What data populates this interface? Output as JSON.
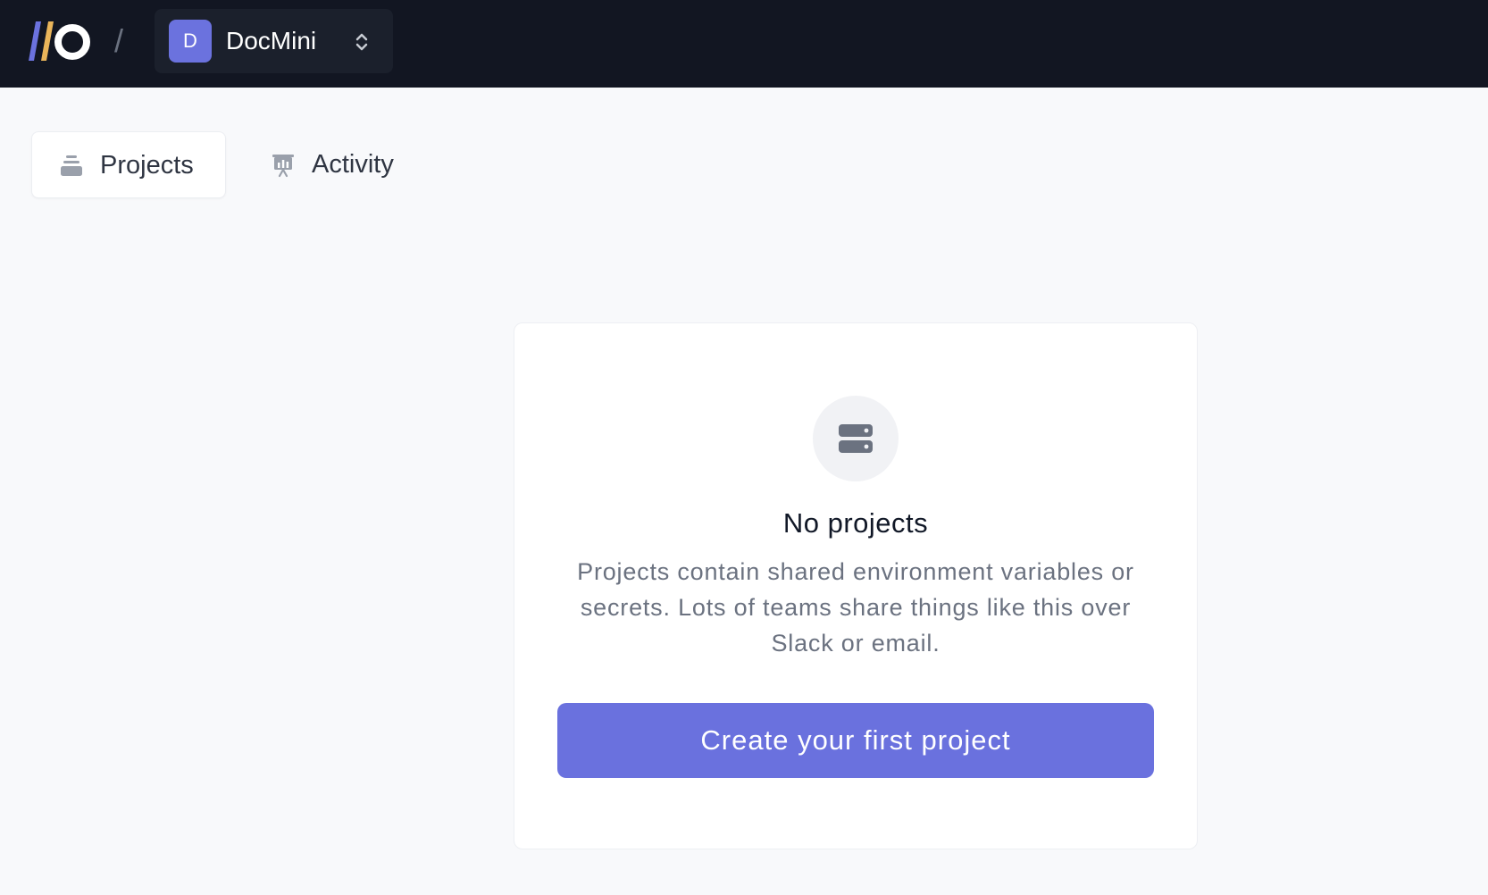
{
  "header": {
    "separator": "/",
    "team": {
      "avatar_letter": "D",
      "name": "DocMini"
    }
  },
  "tabs": [
    {
      "label": "Projects",
      "icon": "stack-icon",
      "active": true
    },
    {
      "label": "Activity",
      "icon": "presentation-chart-icon",
      "active": false
    }
  ],
  "empty_state": {
    "icon": "server-icon",
    "title": "No projects",
    "description": "Projects contain shared environment variables or secrets. Lots of teams share things like this over Slack or email.",
    "button_label": "Create your first project"
  },
  "colors": {
    "topbar_bg": "#121622",
    "accent": "#6a71de",
    "logo_bar_purple": "#6b72de",
    "logo_bar_yellow": "#eab55a",
    "page_bg": "#f8f9fb"
  }
}
